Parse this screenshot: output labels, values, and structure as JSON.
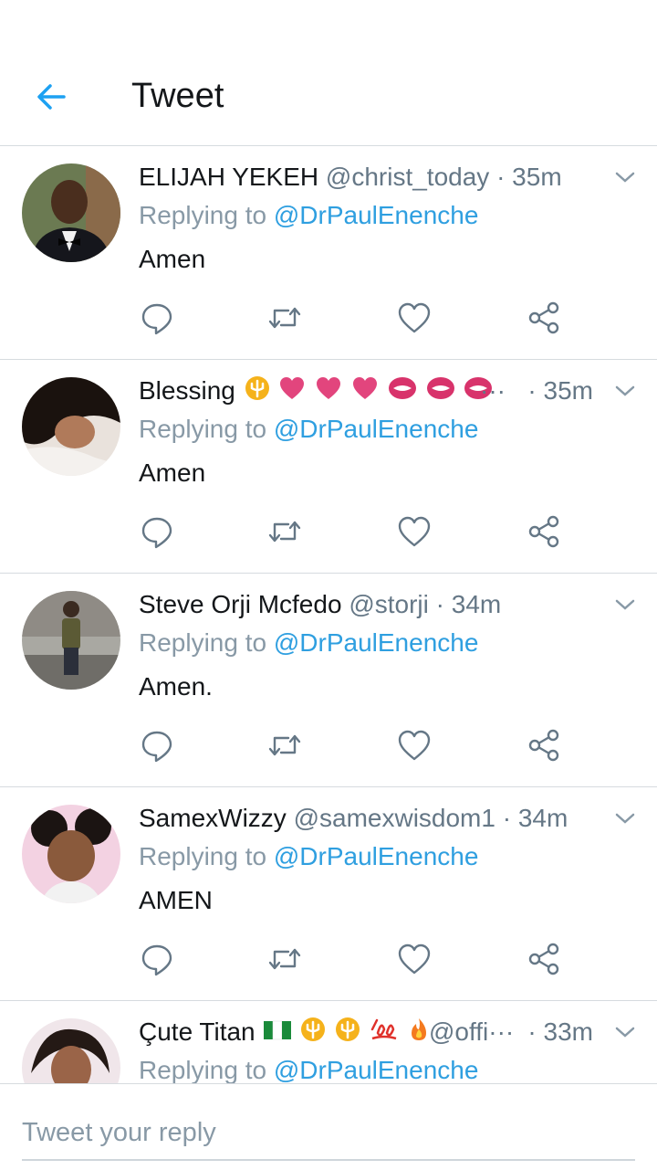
{
  "header": {
    "title": "Tweet"
  },
  "tweets": [
    {
      "name": "ELIJAH YEKEH",
      "handle": "@christ_today",
      "time": "· 35m",
      "reply_prefix": "Replying to ",
      "reply_to": "@DrPaulEnenche",
      "text": "Amen"
    },
    {
      "name": "Blessing",
      "handle": "···",
      "time": "· 35m",
      "reply_prefix": "Replying to ",
      "reply_to": "@DrPaulEnenche",
      "text": "Amen"
    },
    {
      "name": "Steve Orji Mcfedo",
      "handle": "@storji",
      "time": "· 34m",
      "reply_prefix": "Replying to ",
      "reply_to": "@DrPaulEnenche",
      "text": "Amen."
    },
    {
      "name": "SamexWizzy",
      "handle": "@samexwisdom1",
      "time": "· 34m",
      "reply_prefix": "Replying to ",
      "reply_to": "@DrPaulEnenche",
      "text": "AMEN"
    },
    {
      "name": "Çute Titan",
      "handle": "@offi···",
      "time": "· 33m",
      "reply_prefix": "Replying to ",
      "reply_to": "@DrPaulEnenche",
      "text": ""
    }
  ],
  "composer": {
    "placeholder": "Tweet your reply"
  },
  "colors": {
    "accent": "#1da1f2",
    "mention": "#2f9fe0",
    "muted": "#657786",
    "divider": "#d6dbdf"
  }
}
